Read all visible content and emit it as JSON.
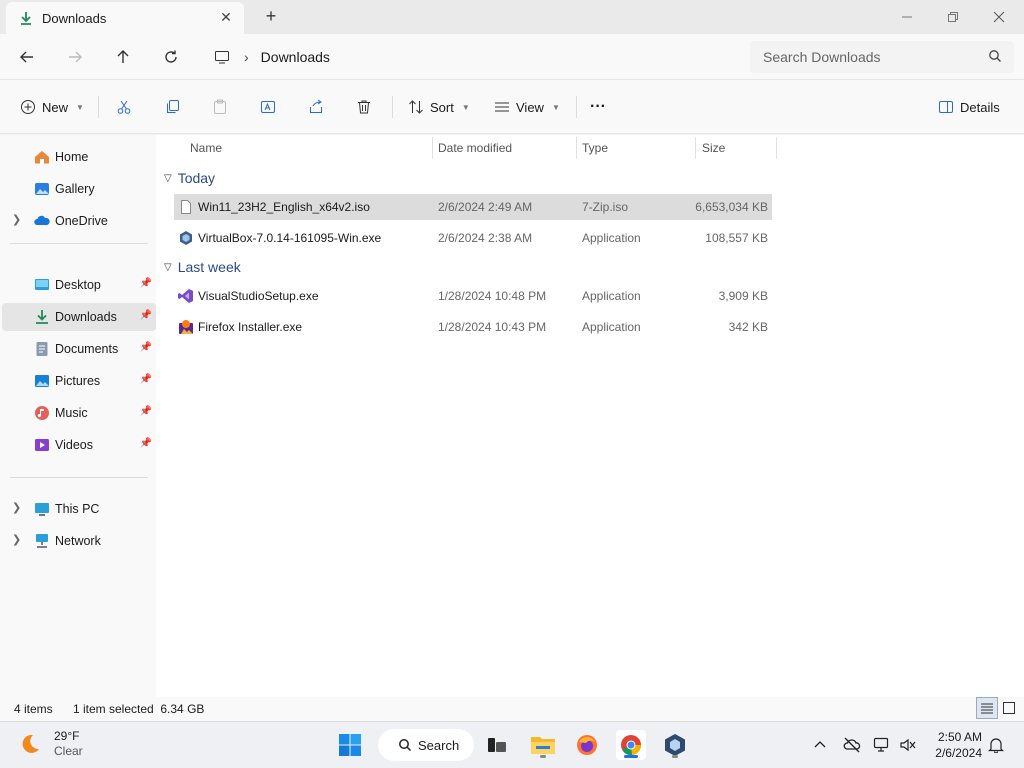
{
  "window": {
    "tab_title": "Downloads",
    "tab_close": "✕",
    "new_tab": "+"
  },
  "address": {
    "location": "Downloads",
    "separator": "›",
    "search_placeholder": "Search Downloads"
  },
  "commands": {
    "new_label": "New",
    "sort_label": "Sort",
    "view_label": "View",
    "more_label": "···",
    "details_label": "Details"
  },
  "sidebar": {
    "items": [
      {
        "label": "Home",
        "icon": "home-icon"
      },
      {
        "label": "Gallery",
        "icon": "gallery-icon"
      },
      {
        "label": "OneDrive",
        "icon": "onedrive-icon"
      },
      {
        "label": "Desktop",
        "icon": "desktop-icon"
      },
      {
        "label": "Downloads",
        "icon": "downloads-icon"
      },
      {
        "label": "Documents",
        "icon": "documents-icon"
      },
      {
        "label": "Pictures",
        "icon": "pictures-icon"
      },
      {
        "label": "Music",
        "icon": "music-icon"
      },
      {
        "label": "Videos",
        "icon": "videos-icon"
      },
      {
        "label": "This PC",
        "icon": "this-pc-icon"
      },
      {
        "label": "Network",
        "icon": "network-icon"
      }
    ]
  },
  "columns": {
    "name": "Name",
    "date": "Date modified",
    "type": "Type",
    "size": "Size"
  },
  "groups": {
    "today": "Today",
    "last_week": "Last week"
  },
  "files": [
    {
      "name": "Win11_23H2_English_x64v2.iso",
      "date": "2/6/2024 2:49 AM",
      "type": "7-Zip.iso",
      "size": "6,653,034 KB",
      "icon": "iso-file-icon"
    },
    {
      "name": "VirtualBox-7.0.14-161095-Win.exe",
      "date": "2/6/2024 2:38 AM",
      "type": "Application",
      "size": "108,557 KB",
      "icon": "virtualbox-icon"
    },
    {
      "name": "VisualStudioSetup.exe",
      "date": "1/28/2024 10:48 PM",
      "type": "Application",
      "size": "3,909 KB",
      "icon": "visual-studio-icon"
    },
    {
      "name": "Firefox Installer.exe",
      "date": "1/28/2024 10:43 PM",
      "type": "Application",
      "size": "342 KB",
      "icon": "firefox-installer-icon"
    }
  ],
  "status": {
    "item_count": "4 items",
    "selection": "1 item selected  6.34 GB"
  },
  "taskbar": {
    "temperature": "29°F",
    "condition": "Clear",
    "search_label": "Search",
    "time": "2:50 AM",
    "date": "2/6/2024"
  },
  "colors": {
    "accent": "#1a73e8",
    "group_header": "#2c4a8a",
    "selection": "#dcdcdc",
    "download_green": "#1e8a5a"
  }
}
